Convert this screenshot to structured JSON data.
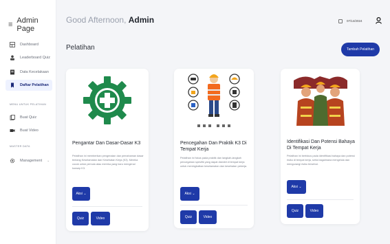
{
  "sidebar": {
    "brand": "Admin Page",
    "items": [
      {
        "label": "Dashboard",
        "icon": "dashboard-icon"
      },
      {
        "label": "Leaderboard Quiz",
        "icon": "leaderboard-icon"
      },
      {
        "label": "Data Kecelakaan",
        "icon": "document-icon"
      },
      {
        "label": "Daftar Pelatihan",
        "icon": "training-icon"
      }
    ],
    "section1": "MENU UNTUK PELATIHAN",
    "section1_items": [
      {
        "label": "Buat Quiz",
        "icon": "quiz-icon"
      },
      {
        "label": "Buat Video",
        "icon": "video-icon"
      }
    ],
    "section2": "MASTER DATA",
    "section2_items": [
      {
        "label": "Management",
        "icon": "gear-icon"
      }
    ]
  },
  "header": {
    "greeting": "Good Afternoon,",
    "user": "Admin",
    "date": "07/14/2024"
  },
  "main": {
    "title": "Pelatihan",
    "add_button": "Tambah Pelatihan",
    "cards": [
      {
        "title": "Pengantar Dan Dasar-Dasar K3",
        "desc": "Pelatihan ini memberikan pengenalan dan pemahaman dasar tentang Keselamatan dan Kesehatan Kerja (K3). Mereka cocok untuk pemula atau mereka yang baru mengenal konsep K3.",
        "action": "Aksi",
        "quiz": "Quiz",
        "video": "Video"
      },
      {
        "title": "Pencegahan Dan Praktik K3 Di Tempat Kerja",
        "desc": "Pelatihan ini fokus pada praktik dan langkah-langkah pencegahan spesifik yang dapat diambil di tempat kerja untuk meningkatkan keselamatan dan kesehatan pekerja.",
        "action": "Aksi",
        "quiz": "Quiz",
        "video": "Video"
      },
      {
        "title": "Identifikasi Dan Potensi Bahaya Di Tempat Kerja",
        "desc": "Pelatihan ini berfokus pada identifikasi bahaya dan potensi risiko di tempat kerja, serta bagaimana mengelola dan mengurangi risiko tersebut.",
        "action": "Aksi",
        "quiz": "Quiz",
        "video": "Video"
      }
    ]
  },
  "colors": {
    "primary": "#1f3aa8",
    "safety_green": "#1f8a4c",
    "background": "#f4f5f8"
  }
}
